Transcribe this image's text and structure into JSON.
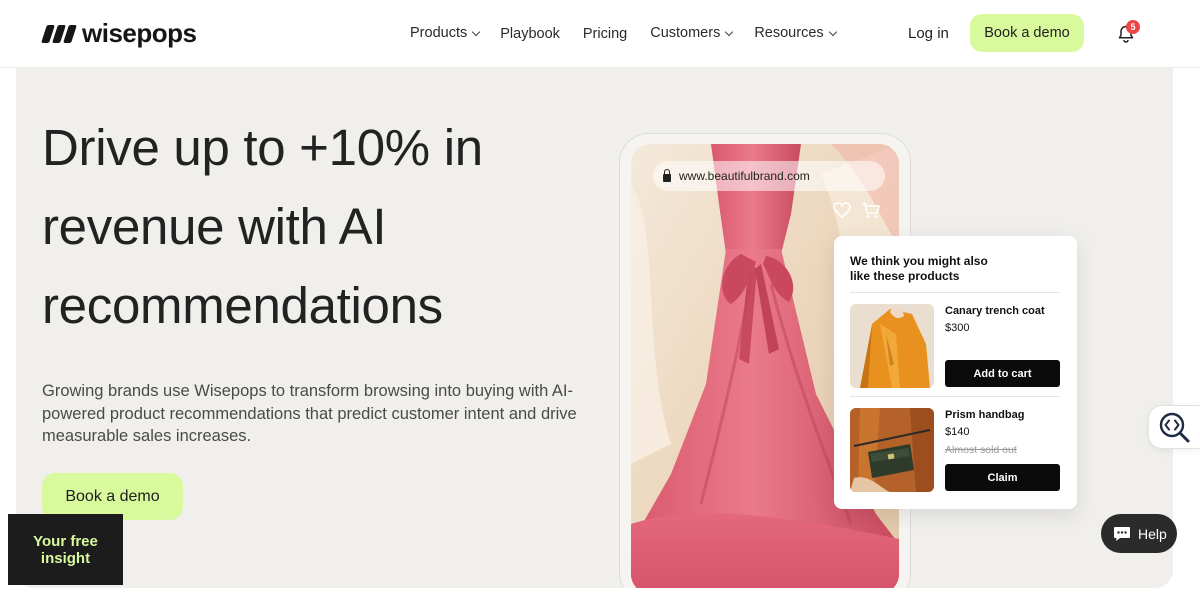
{
  "header": {
    "brand": "wisepops",
    "nav": [
      {
        "label": "Products",
        "has_dropdown": true
      },
      {
        "label": "Playbook",
        "has_dropdown": false
      },
      {
        "label": "Pricing",
        "has_dropdown": false
      },
      {
        "label": "Customers",
        "has_dropdown": true
      },
      {
        "label": "Resources",
        "has_dropdown": true
      }
    ],
    "login_label": "Log in",
    "demo_label": "Book a demo",
    "notification_count": "5"
  },
  "hero": {
    "headline_lines": [
      "Drive up to +10% in",
      "revenue with AI",
      "recommendations"
    ],
    "subtext": "Growing brands use Wisepops to transform browsing into buying with AI-powered product recommendations that predict customer intent and drive measurable sales increases.",
    "cta_label": "Book a demo"
  },
  "phone": {
    "url": "www.beautifulbrand.com"
  },
  "recommendations": {
    "title": "We think you might also like these products",
    "products": [
      {
        "name": "Canary trench coat",
        "price": "$300",
        "old_text": "",
        "button": "Add to cart"
      },
      {
        "name": "Prism handbag",
        "price": "$140",
        "old_text": "Almost sold out",
        "button": "Claim"
      }
    ]
  },
  "widgets": {
    "help_label": "Help",
    "insight_label": "Your free insight"
  },
  "colors": {
    "accent": "#d9f99d",
    "hero_bg": "#f0efec",
    "dark": "#0b0b0b",
    "badge": "#ef4444"
  }
}
